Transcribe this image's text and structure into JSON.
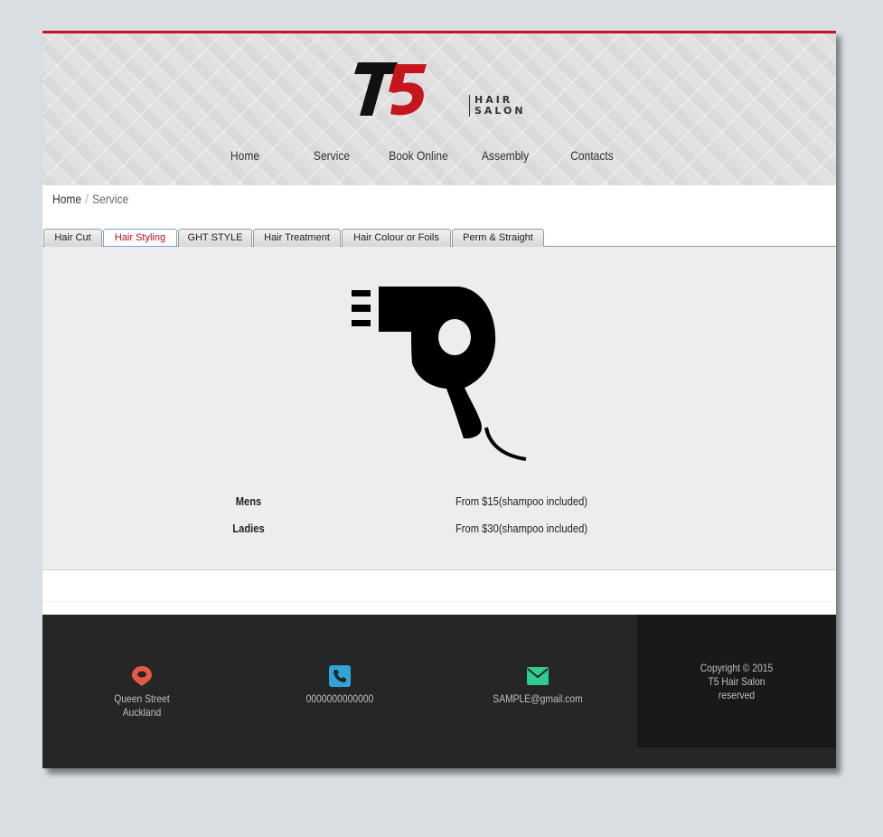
{
  "brand": {
    "logo_mark": "T5",
    "logo_word_1": "HAIR",
    "logo_word_2": "SALON",
    "accent_color": "#c5161d"
  },
  "nav": {
    "items": [
      {
        "label": "Home"
      },
      {
        "label": "Service"
      },
      {
        "label": "Book Online"
      },
      {
        "label": "Assembly"
      },
      {
        "label": "Contacts"
      }
    ]
  },
  "breadcrumb": {
    "home": "Home",
    "separator": "/",
    "current": "Service"
  },
  "tabs": [
    {
      "label": "Hair Cut"
    },
    {
      "label": "Hair Styling"
    },
    {
      "label": "GHT STYLE"
    },
    {
      "label": "Hair Treatment"
    },
    {
      "label": "Hair Colour or Foils"
    },
    {
      "label": "Perm & Straight"
    }
  ],
  "active_tab": "Hair Styling",
  "service": {
    "icon": "hair-dryer-icon",
    "prices": [
      {
        "label": "Mens",
        "value": "From $15(shampoo included)"
      },
      {
        "label": "Ladies",
        "value": "From $30(shampoo included)"
      }
    ]
  },
  "footer": {
    "address_line_1": "Queen Street",
    "address_line_2": "Auckland",
    "phone": "0000000000000",
    "email": "SAMPLE@gmail.com",
    "copyright_line_1": "Copyright © 2015",
    "copyright_line_2": "T5 Hair Salon",
    "copyright_line_3": "reserved",
    "icon_colors": {
      "location": "#e8584a",
      "phone": "#2fa4d9",
      "email": "#2ecc8f"
    }
  }
}
